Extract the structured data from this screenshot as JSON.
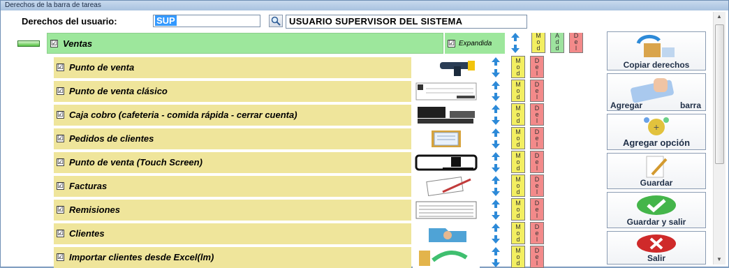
{
  "window": {
    "title": "Derechos de la barra de tareas"
  },
  "header": {
    "user_label": "Derechos del usuario:",
    "user_code": "SUP",
    "user_name": "USUARIO SUPERVISOR DEL SISTEMA"
  },
  "category": {
    "label": "Ventas",
    "checked": "☑",
    "expandida_label": "Expandida"
  },
  "items": [
    {
      "label": "Punto de venta",
      "icon": "barcode-scanner-icon"
    },
    {
      "label": "Punto de venta clásico",
      "icon": "classic-pos-screen-icon"
    },
    {
      "label": "Caja cobro (cafeteria - comida rápida - cerrar cuenta)",
      "icon": "cash-register-icon"
    },
    {
      "label": "Pedidos de clientes",
      "icon": "clipboard-orders-icon"
    },
    {
      "label": "Punto de venta (Touch Screen)",
      "icon": "touch-screen-icon"
    },
    {
      "label": "Facturas",
      "icon": "invoice-pen-icon"
    },
    {
      "label": "Remisiones",
      "icon": "remission-document-icon"
    },
    {
      "label": "Clientes",
      "icon": "client-folder-icon"
    },
    {
      "label": "Importar clientes desde Excel(lm)",
      "icon": "import-excel-icon"
    }
  ],
  "small_buttons": {
    "mod": "M o d",
    "add": "A d d",
    "del": "D e l"
  },
  "side_buttons": {
    "copiar": "Copiar derechos",
    "agregar_left": "Agregar",
    "agregar_right": "barra",
    "agregar_opcion": "Agregar opción",
    "guardar": "Guardar",
    "guardar_salir": "Guardar y salir",
    "salir": "Salir"
  }
}
